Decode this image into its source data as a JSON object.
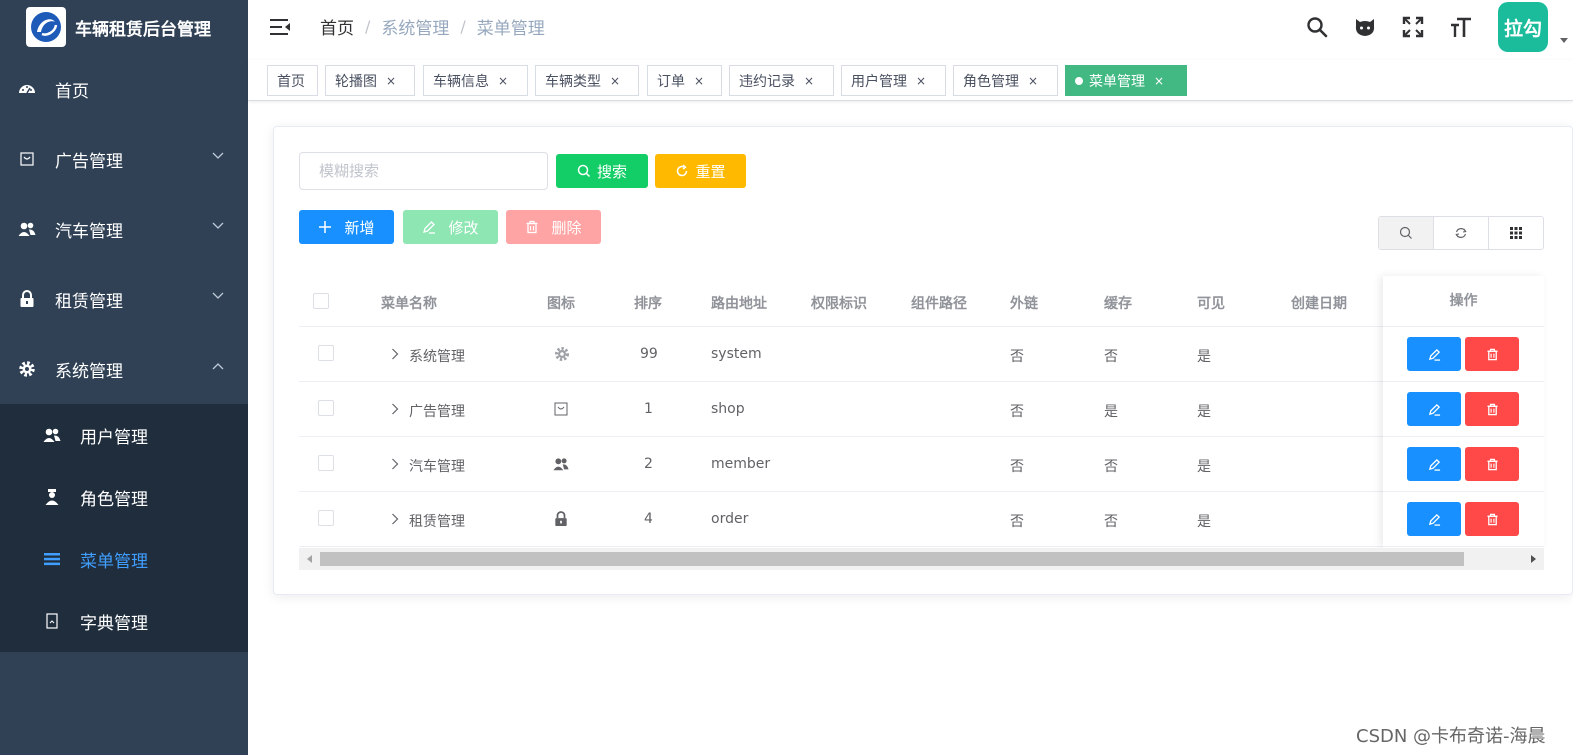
{
  "app": {
    "title": "车辆租赁后台管理"
  },
  "sidebar": {
    "items": [
      {
        "label": "首页",
        "icon": "dashboard-icon"
      },
      {
        "label": "广告管理",
        "icon": "shopping-bag-icon"
      },
      {
        "label": "汽车管理",
        "icon": "members-icon"
      },
      {
        "label": "租赁管理",
        "icon": "lock-icon"
      },
      {
        "label": "系统管理",
        "icon": "gear-icon"
      }
    ],
    "submenu": [
      {
        "label": "用户管理",
        "icon": "user-icon"
      },
      {
        "label": "角色管理",
        "icon": "role-icon"
      },
      {
        "label": "菜单管理",
        "icon": "list-icon"
      },
      {
        "label": "字典管理",
        "icon": "dictionary-icon"
      }
    ]
  },
  "navbar": {
    "breadcrumb": [
      "首页",
      "系统管理",
      "菜单管理"
    ],
    "avatar_text": "拉勾"
  },
  "tags": [
    {
      "label": "首页"
    },
    {
      "label": "轮播图"
    },
    {
      "label": "车辆信息"
    },
    {
      "label": "车辆类型"
    },
    {
      "label": "订单"
    },
    {
      "label": "违约记录"
    },
    {
      "label": "用户管理"
    },
    {
      "label": "角色管理"
    },
    {
      "label": "菜单管理"
    }
  ],
  "tag_close": "×",
  "search": {
    "placeholder": "模糊搜索",
    "search_label": "搜索",
    "reset_label": "重置"
  },
  "toolbar": {
    "add_label": "新增",
    "edit_label": "修改",
    "delete_label": "删除"
  },
  "table": {
    "columns": [
      "菜单名称",
      "图标",
      "排序",
      "路由地址",
      "权限标识",
      "组件路径",
      "外链",
      "缓存",
      "可见",
      "创建日期",
      "操作"
    ],
    "rows": [
      {
        "name": "系统管理",
        "icon": "gear-icon",
        "sort": "99",
        "path": "system",
        "external": "否",
        "cache": "否",
        "visible": "是"
      },
      {
        "name": "广告管理",
        "icon": "shopping-bag-icon",
        "sort": "1",
        "path": "shop",
        "external": "否",
        "cache": "是",
        "visible": "是"
      },
      {
        "name": "汽车管理",
        "icon": "members-icon",
        "sort": "2",
        "path": "member",
        "external": "否",
        "cache": "否",
        "visible": "是"
      },
      {
        "name": "租赁管理",
        "icon": "lock-icon",
        "sort": "4",
        "path": "order",
        "external": "否",
        "cache": "否",
        "visible": "是"
      }
    ]
  },
  "colors": {
    "sidebar_bg": "#304156",
    "submenu_bg": "#1f2d3d",
    "active_menu": "#409eff",
    "active_tag": "#42b983",
    "primary": "#1890ff",
    "success": "#13ce66",
    "warning": "#ffba00",
    "danger": "#ff4949"
  },
  "watermark": "CSDN @卡布奇诺-海晨"
}
